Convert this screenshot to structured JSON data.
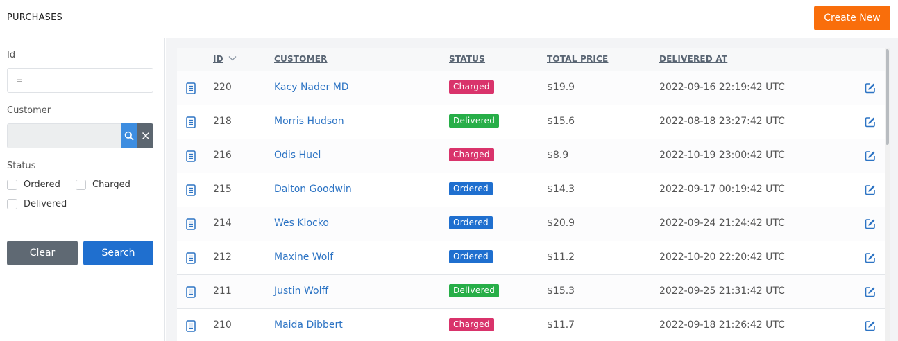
{
  "header": {
    "title": "PURCHASES",
    "create_label": "Create New"
  },
  "filters": {
    "id_label": "Id",
    "id_placeholder": "=",
    "customer_label": "Customer",
    "status_label": "Status",
    "statuses": [
      "Ordered",
      "Charged",
      "Delivered"
    ],
    "clear_label": "Clear",
    "search_label": "Search"
  },
  "table": {
    "columns": [
      "ID",
      "CUSTOMER",
      "STATUS",
      "TOTAL PRICE",
      "DELIVERED AT"
    ],
    "rows": [
      {
        "id": "220",
        "customer": "Kacy Nader MD",
        "status": "Charged",
        "price": "$19.9",
        "delivered_at": "2022-09-16 22:19:42 UTC"
      },
      {
        "id": "218",
        "customer": "Morris Hudson",
        "status": "Delivered",
        "price": "$15.6",
        "delivered_at": "2022-08-18 23:27:42 UTC"
      },
      {
        "id": "216",
        "customer": "Odis Huel",
        "status": "Charged",
        "price": "$8.9",
        "delivered_at": "2022-10-19 23:00:42 UTC"
      },
      {
        "id": "215",
        "customer": "Dalton Goodwin",
        "status": "Ordered",
        "price": "$14.3",
        "delivered_at": "2022-09-17 00:19:42 UTC"
      },
      {
        "id": "214",
        "customer": "Wes Klocko",
        "status": "Ordered",
        "price": "$20.9",
        "delivered_at": "2022-09-24 21:24:42 UTC"
      },
      {
        "id": "212",
        "customer": "Maxine Wolf",
        "status": "Ordered",
        "price": "$11.2",
        "delivered_at": "2022-10-20 22:20:42 UTC"
      },
      {
        "id": "211",
        "customer": "Justin Wolff",
        "status": "Delivered",
        "price": "$15.3",
        "delivered_at": "2022-09-25 21:31:42 UTC"
      },
      {
        "id": "210",
        "customer": "Maida Dibbert",
        "status": "Charged",
        "price": "$11.7",
        "delivered_at": "2022-09-18 21:26:42 UTC"
      }
    ]
  },
  "colors": {
    "accent": "#f96e0b",
    "primary": "#1f6fcf",
    "charged": "#d9336b",
    "delivered": "#27ae48",
    "ordered": "#1f6fcf"
  },
  "icons": {
    "row_icon": "document-icon",
    "edit_icon": "edit-icon",
    "sort_icon": "chevron-down-icon"
  }
}
